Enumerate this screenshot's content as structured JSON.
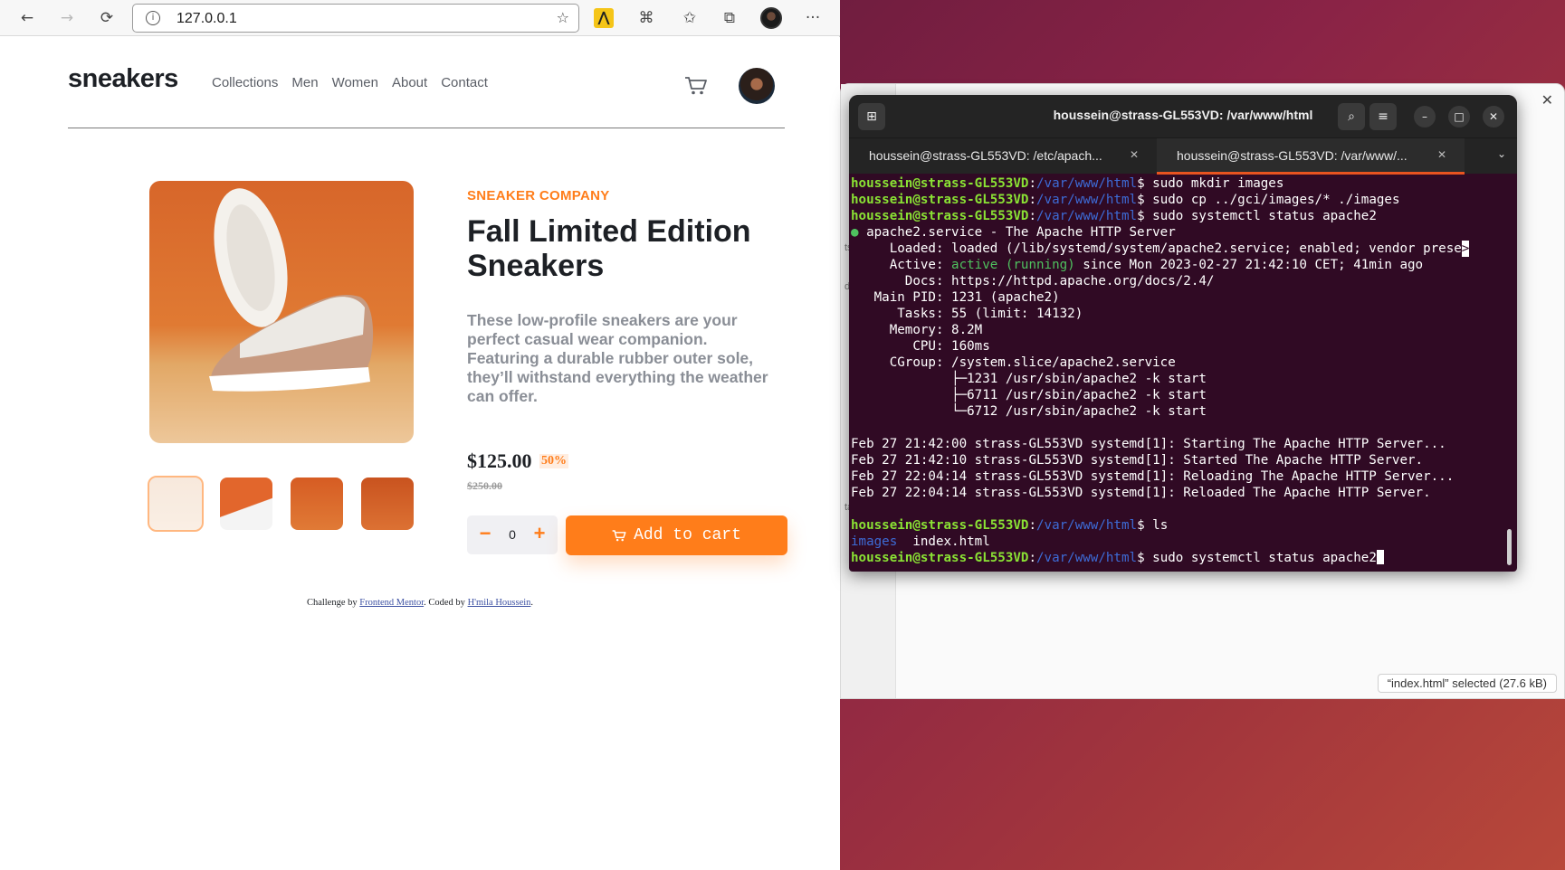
{
  "browser": {
    "url": "127.0.0.1",
    "back_icon": "←",
    "forward_icon": "→",
    "reload_icon": "⟳",
    "info_icon": "i",
    "favorite_icon": "☆",
    "ext_label": "⋀",
    "puzzle_icon": "⌘",
    "favorites_icon": "✩",
    "collections_icon": "⧉",
    "menu_icon": "···"
  },
  "site": {
    "logo": "sneakers",
    "nav": [
      "Collections",
      "Men",
      "Women",
      "About",
      "Contact"
    ],
    "company": "SNEAKER COMPANY",
    "title": "Fall Limited Edition Sneakers",
    "description": "These low-profile sneakers are your perfect casual wear companion. Featuring a durable rubber outer sole, they’ll withstand everything the weather can offer.",
    "price": "$125.00",
    "discount": "50%",
    "old_price": "$250.00",
    "quantity": "0",
    "minus_label": "−",
    "plus_label": "+",
    "add_to_cart": "Add to cart",
    "accent_color": "#ff7d1a",
    "footer": {
      "prefix": "Challenge by ",
      "link1": "Frontend Mentor",
      "middle": ". Coded by ",
      "link2": "H'mila Houssein",
      "suffix": "."
    }
  },
  "files": {
    "close_icon": "✕",
    "status": "“index.html” selected  (27.6 kB)",
    "stub_letters": [
      "ts",
      "ds",
      "ta"
    ]
  },
  "terminal": {
    "title": "houssein@strass-GL553VD: /var/www/html",
    "new_tab_icon": "⊞",
    "search_icon": "⌕",
    "menu_icon": "≡",
    "minimize_icon": "–",
    "maximize_icon": "□",
    "close_icon": "✕",
    "dropdown_icon": "⌄",
    "tab_close_icon": "✕",
    "tabs": [
      {
        "label": "houssein@strass-GL553VD: /etc/apach..."
      },
      {
        "label": "houssein@strass-GL553VD: /var/www/..."
      }
    ],
    "prompt_user": "houssein@strass-GL553VD",
    "prompt_path": "/var/www/html",
    "prompt_sep": ":",
    "prompt_dollar": "$ ",
    "cmd1": "sudo mkdir images",
    "cmd2": "sudo cp ../gci/images/* ./images",
    "cmd3": "sudo systemctl status apache2",
    "status_dot": "●",
    "svc_line": " apache2.service - The Apache HTTP Server",
    "loaded_line": "     Loaded: loaded (/lib/systemd/system/apache2.service; enabled; vendor prese",
    "loaded_overflow": ">",
    "active_prefix": "     Active: ",
    "active_state": "active (running)",
    "active_suffix": " since Mon 2023-02-27 21:42:10 CET; 41min ago",
    "docs_line": "       Docs: https://httpd.apache.org/docs/2.4/",
    "pid_line": "   Main PID: 1231 (apache2)",
    "tasks_line": "      Tasks: 55 (limit: 14132)",
    "memory_line": "     Memory: 8.2M",
    "cpu_line": "        CPU: 160ms",
    "cgroup_line": "     CGroup: /system.slice/apache2.service",
    "proc1": "             ├─1231 /usr/sbin/apache2 -k start",
    "proc2": "             ├─6711 /usr/sbin/apache2 -k start",
    "proc3": "             └─6712 /usr/sbin/apache2 -k start",
    "log1": "Feb 27 21:42:00 strass-GL553VD systemd[1]: Starting The Apache HTTP Server...",
    "log2": "Feb 27 21:42:10 strass-GL553VD systemd[1]: Started The Apache HTTP Server.",
    "log3": "Feb 27 22:04:14 strass-GL553VD systemd[1]: Reloading The Apache HTTP Server...",
    "log4": "Feb 27 22:04:14 strass-GL553VD systemd[1]: Reloaded The Apache HTTP Server.",
    "cmd4": "ls",
    "ls_dir": "images",
    "ls_file": "  index.html",
    "cmd5": "sudo systemctl status apache2"
  }
}
